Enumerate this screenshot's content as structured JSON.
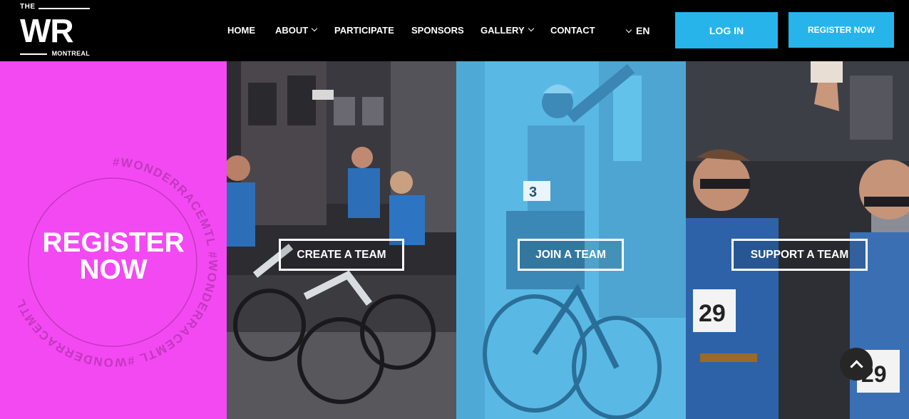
{
  "logo": {
    "top": "THE",
    "main": "WR",
    "city": "MONTREAL"
  },
  "nav": {
    "items": [
      {
        "label": "HOME",
        "has_dropdown": false
      },
      {
        "label": "ABOUT",
        "has_dropdown": true
      },
      {
        "label": "PARTICIPATE",
        "has_dropdown": false
      },
      {
        "label": "SPONSORS",
        "has_dropdown": false
      },
      {
        "label": "GALLERY",
        "has_dropdown": true
      },
      {
        "label": "CONTACT",
        "has_dropdown": false
      }
    ],
    "language": "EN"
  },
  "header_buttons": {
    "login": "LOG IN",
    "register": "REGISTER NOW"
  },
  "hero": {
    "register_line1": "REGISTER",
    "register_line2": "NOW",
    "ring_text": "#WONDERRACEMTL #WONDERRACEMTL #WONDERRACEMTL",
    "create_team": "CREATE A TEAM",
    "join_team": "JOIN A TEAM",
    "support_team": "SUPPORT A TEAM",
    "bib_numbers": [
      "3",
      "29",
      "29"
    ]
  },
  "colors": {
    "accent": "#27b4ea",
    "pink": "#f349f2",
    "header_bg": "#000000",
    "blue_overlay": "#5cbde8"
  },
  "icons": {
    "back_to_top": "chevron-up-icon",
    "dropdown": "chevron-down-icon"
  }
}
